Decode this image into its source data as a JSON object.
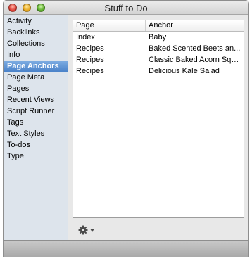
{
  "window": {
    "title": "Stuff to Do"
  },
  "sidebar": {
    "items": [
      {
        "label": "Activity"
      },
      {
        "label": "Backlinks"
      },
      {
        "label": "Collections"
      },
      {
        "label": "Info"
      },
      {
        "label": "Page Anchors",
        "selected": true
      },
      {
        "label": "Page Meta"
      },
      {
        "label": "Pages"
      },
      {
        "label": "Recent Views"
      },
      {
        "label": "Script Runner"
      },
      {
        "label": "Tags"
      },
      {
        "label": "Text Styles"
      },
      {
        "label": "To-dos"
      },
      {
        "label": "Type"
      }
    ]
  },
  "table": {
    "columns": [
      "Page",
      "Anchor"
    ],
    "rows": [
      {
        "page": "Index",
        "anchor": "Baby"
      },
      {
        "page": "Recipes",
        "anchor": "Baked Scented Beets an..."
      },
      {
        "page": "Recipes",
        "anchor": "Classic Baked Acorn Squ..."
      },
      {
        "page": "Recipes",
        "anchor": "Delicious Kale Salad"
      }
    ]
  },
  "actions": {
    "gear_icon": "gear-icon",
    "menu_icon": "chevron-down-icon"
  },
  "colors": {
    "selection": "#4a82c9",
    "sidebar_bg": "#dde4ec"
  }
}
